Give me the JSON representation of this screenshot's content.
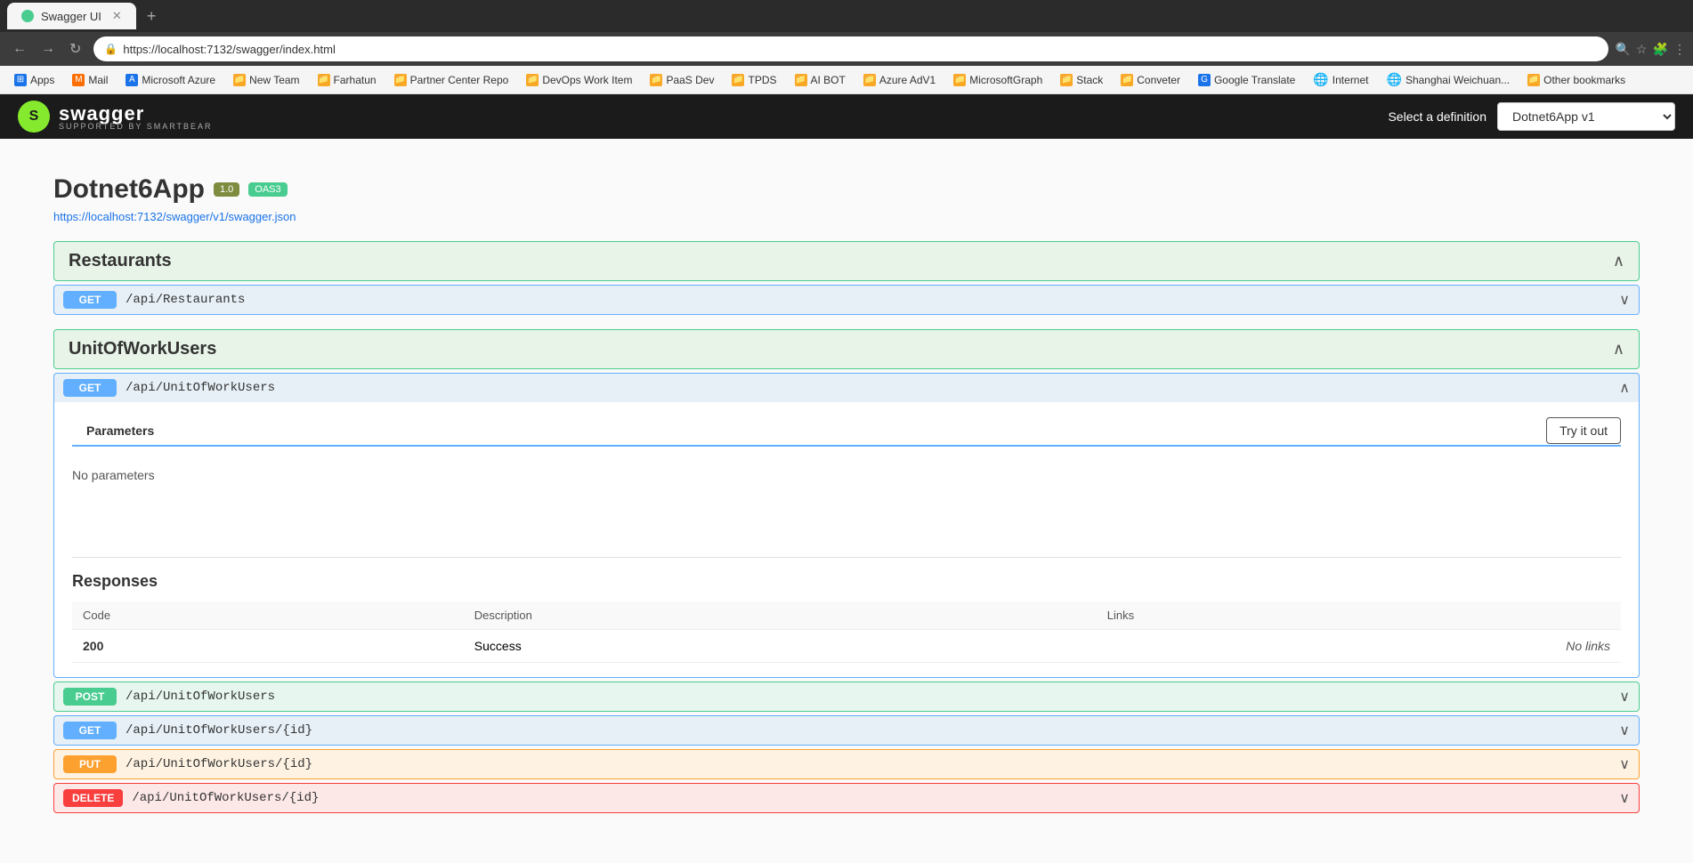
{
  "browser": {
    "url": "https://localhost:7132/swagger/index.html",
    "tab_label": "Swagger UI",
    "nav": {
      "back_label": "←",
      "forward_label": "→",
      "refresh_label": "↻",
      "home_label": "⌂"
    },
    "bookmarks": [
      {
        "label": "Apps",
        "icon_type": "grid",
        "color": "blue2"
      },
      {
        "label": "Mail",
        "icon_type": "M",
        "color": "orange"
      },
      {
        "label": "Microsoft Azure",
        "icon_type": "A",
        "color": "blue2"
      },
      {
        "label": "New Team",
        "icon_type": "folder",
        "color": "folder"
      },
      {
        "label": "Farhatun",
        "icon_type": "folder",
        "color": "folder"
      },
      {
        "label": "Partner Center Repo",
        "icon_type": "folder",
        "color": "folder"
      },
      {
        "label": "DevOps Work Item",
        "icon_type": "folder",
        "color": "folder"
      },
      {
        "label": "PaaS Dev",
        "icon_type": "folder",
        "color": "folder"
      },
      {
        "label": "TPDS",
        "icon_type": "folder",
        "color": "folder"
      },
      {
        "label": "AI BOT",
        "icon_type": "folder",
        "color": "folder"
      },
      {
        "label": "Azure AdV1",
        "icon_type": "folder",
        "color": "folder"
      },
      {
        "label": "MicrosoftGraph",
        "icon_type": "folder",
        "color": "folder"
      },
      {
        "label": "Stack",
        "icon_type": "folder",
        "color": "folder"
      },
      {
        "label": "Conveter",
        "icon_type": "folder",
        "color": "folder"
      },
      {
        "label": "Google Translate",
        "icon_type": "G",
        "color": "blue2"
      },
      {
        "label": "Internet",
        "icon_type": "🌐",
        "color": "teal"
      },
      {
        "label": "Shanghai Weichuan...",
        "icon_type": "🌐",
        "color": "teal"
      },
      {
        "label": "Other bookmarks",
        "icon_type": "folder",
        "color": "folder"
      }
    ]
  },
  "swagger": {
    "logo_letter": "S",
    "logo_text": "swagger",
    "logo_sub": "SUPPORTED BY SMARTBEAR",
    "select_label": "Select a definition",
    "definition_value": "Dotnet6App v1",
    "definition_options": [
      "Dotnet6App v1"
    ]
  },
  "app": {
    "title": "Dotnet6App",
    "version_badge": "1.0",
    "oas_badge": "OAS3",
    "swagger_json_url": "https://localhost:7132/swagger/v1/swagger.json"
  },
  "sections": [
    {
      "id": "restaurants",
      "title": "Restaurants",
      "collapsed": false,
      "endpoints": [
        {
          "method": "GET",
          "path": "/api/Restaurants",
          "expanded": false
        }
      ]
    },
    {
      "id": "unitofworkusers",
      "title": "UnitOfWorkUsers",
      "collapsed": false,
      "endpoints": [
        {
          "method": "GET",
          "path": "/api/UnitOfWorkUsers",
          "expanded": true,
          "parameters_tab": "Parameters",
          "try_it_out_label": "Try it out",
          "no_params_text": "No parameters",
          "responses_title": "Responses",
          "response_table": {
            "columns": [
              "Code",
              "Description",
              "Links"
            ],
            "rows": [
              {
                "code": "200",
                "description": "Success",
                "links": "No links"
              }
            ]
          }
        },
        {
          "method": "POST",
          "path": "/api/UnitOfWorkUsers",
          "expanded": false
        },
        {
          "method": "GET",
          "path": "/api/UnitOfWorkUsers/{id}",
          "expanded": false
        },
        {
          "method": "PUT",
          "path": "/api/UnitOfWorkUsers/{id}",
          "expanded": false
        },
        {
          "method": "DELETE",
          "path": "/api/UnitOfWorkUsers/{id}",
          "expanded": false
        }
      ]
    }
  ]
}
